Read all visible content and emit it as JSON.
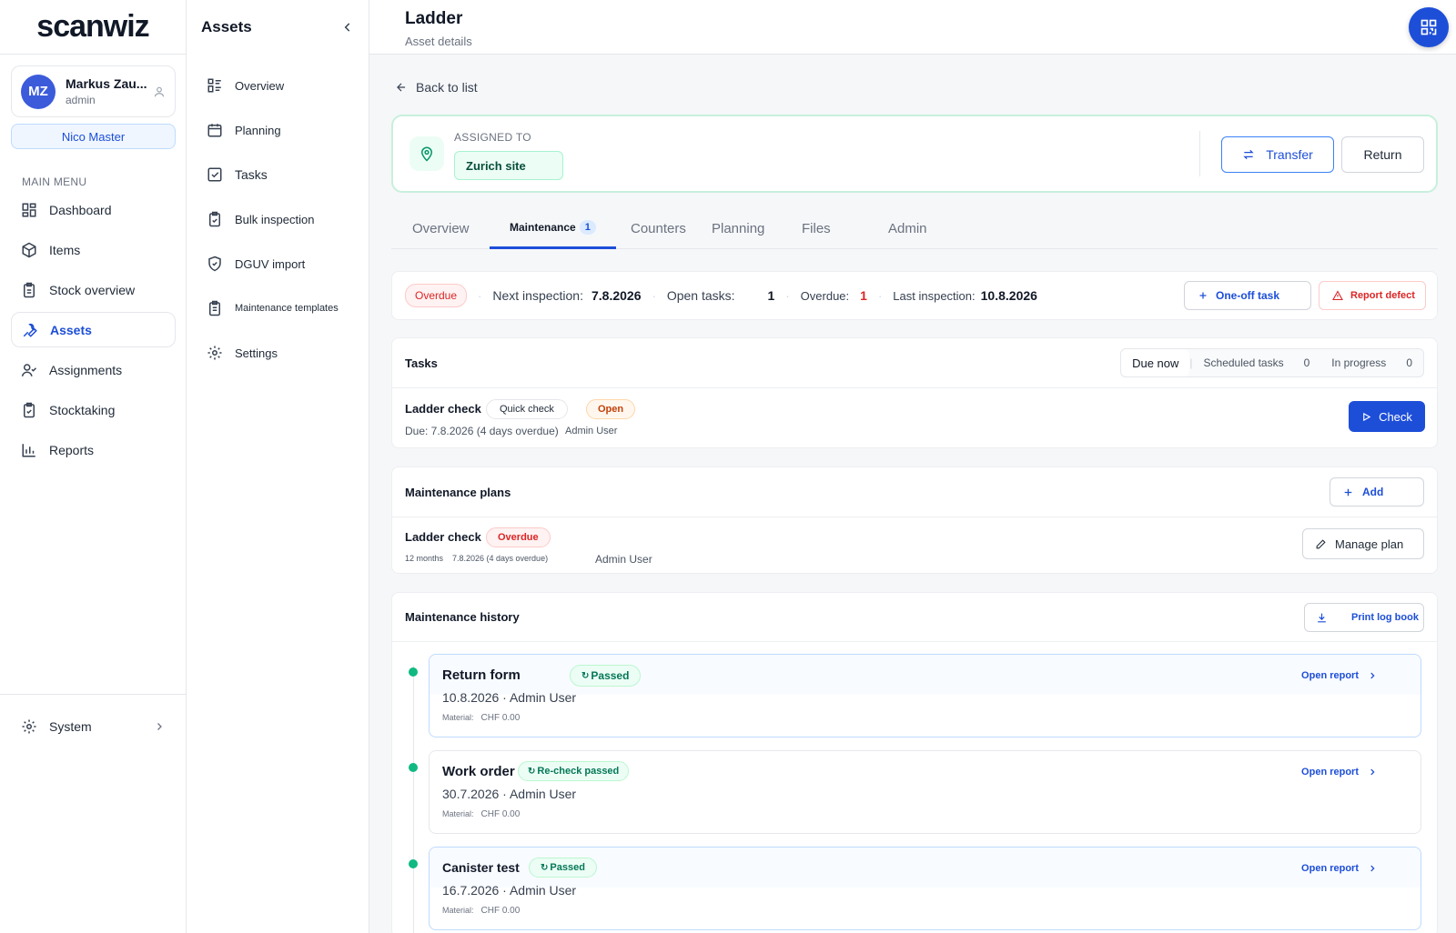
{
  "app": {
    "logo": "scanwiz"
  },
  "user": {
    "initials": "MZ",
    "name": "Markus Zau...",
    "role": "admin",
    "tenant": "Nico Master"
  },
  "main_menu": {
    "title": "MAIN MENU",
    "items": [
      {
        "label": "Dashboard",
        "icon": "dashboard-icon"
      },
      {
        "label": "Items",
        "icon": "box-icon"
      },
      {
        "label": "Stock overview",
        "icon": "clipboard-icon"
      },
      {
        "label": "Assets",
        "icon": "wrench-icon",
        "active": true
      },
      {
        "label": "Assignments",
        "icon": "user-check-icon"
      },
      {
        "label": "Stocktaking",
        "icon": "clipboard-check-icon"
      },
      {
        "label": "Reports",
        "icon": "bar-chart-icon"
      }
    ],
    "system": "System"
  },
  "submenu": {
    "title": "Assets",
    "items": [
      {
        "label": "Overview"
      },
      {
        "label": "Planning"
      },
      {
        "label": "Tasks"
      },
      {
        "label": "Bulk inspection"
      },
      {
        "label": "DGUV import"
      },
      {
        "label": "Maintenance templates"
      },
      {
        "label": "Settings"
      }
    ]
  },
  "page": {
    "title": "Ladder",
    "subtitle": "Asset details",
    "back": "Back to list"
  },
  "assignment": {
    "label": "ASSIGNED TO",
    "site": "Zurich site",
    "transfer": "Transfer",
    "return": "Return"
  },
  "tabs": [
    {
      "label": "Overview"
    },
    {
      "label": "Maintenance",
      "count": "1",
      "active": true
    },
    {
      "label": "Counters"
    },
    {
      "label": "Planning"
    },
    {
      "label": "Files"
    },
    {
      "label": "Admin"
    }
  ],
  "status": {
    "badge": "Overdue",
    "next_label": "Next inspection:",
    "next_value": "7.8.2026",
    "open_label": "Open tasks:",
    "open_value": "1",
    "overdue_label": "Overdue:",
    "overdue_value": "1",
    "last_label": "Last inspection:",
    "last_value": "10.8.2026",
    "oneoff": "One-off task",
    "defect": "Report defect"
  },
  "tasks": {
    "title": "Tasks",
    "filters": {
      "due": "Due now",
      "scheduled": "Scheduled tasks",
      "scheduled_count": "0",
      "progress": "In progress",
      "progress_count": "0"
    },
    "row": {
      "title": "Ladder check",
      "type": "Quick check",
      "status": "Open",
      "due": "Due: 7.8.2026 (4 days overdue)",
      "user": "Admin User",
      "action": "Check"
    }
  },
  "plans": {
    "title": "Maintenance plans",
    "add": "Add",
    "row": {
      "title": "Ladder check",
      "status": "Overdue",
      "interval": "12 months",
      "next": "7.8.2026 (4 days overdue)",
      "user": "Admin User",
      "action": "Manage plan"
    }
  },
  "history": {
    "title": "Maintenance history",
    "print": "Print log book",
    "open_report": "Open report",
    "material_label": "Material:",
    "items": [
      {
        "title": "Return form",
        "badge": "Passed",
        "meta": "10.8.2026 · Admin User",
        "material": "CHF 0.00"
      },
      {
        "title": "Work order",
        "badge": "Re-check passed",
        "meta": "30.7.2026 · Admin User",
        "material": "CHF 0.00"
      },
      {
        "title": "Canister test",
        "badge": "Passed",
        "meta": "16.7.2026 · Admin User",
        "material": "CHF 0.00"
      }
    ]
  },
  "colors": {
    "primary": "#1d4ed8",
    "success": "#10b981",
    "danger": "#dc2626"
  }
}
